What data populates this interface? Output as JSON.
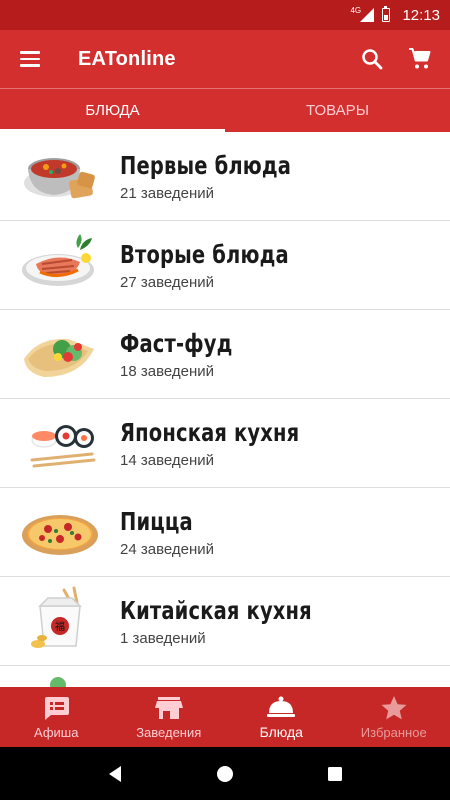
{
  "status_bar": {
    "network": "4G",
    "time": "12:13"
  },
  "app_bar": {
    "title": "EATonline",
    "icons": [
      "menu-icon",
      "search-icon",
      "cart-icon"
    ]
  },
  "tabs": [
    {
      "label": "БЛЮДА",
      "active": true
    },
    {
      "label": "ТОВАРЫ",
      "active": false
    }
  ],
  "categories": [
    {
      "title": "Первые блюда",
      "count": "21 заведений",
      "icon": "soup-bowl-icon"
    },
    {
      "title": "Вторые блюда",
      "count": "27 заведений",
      "icon": "grilled-fish-plate-icon"
    },
    {
      "title": "Фаст-фуд",
      "count": "18 заведений",
      "icon": "wrap-icon"
    },
    {
      "title": "Японская кухня",
      "count": "14 заведений",
      "icon": "sushi-icon"
    },
    {
      "title": "Пицца",
      "count": "24 заведений",
      "icon": "pizza-icon"
    },
    {
      "title": "Китайская кухня",
      "count": "1 заведений",
      "icon": "chinese-box-icon"
    }
  ],
  "bottom_nav": [
    {
      "label": "Афиша",
      "icon": "feed-icon",
      "state": "normal"
    },
    {
      "label": "Заведения",
      "icon": "store-icon",
      "state": "normal"
    },
    {
      "label": "Блюда",
      "icon": "cloche-icon",
      "state": "active"
    },
    {
      "label": "Избранное",
      "icon": "star-icon",
      "state": "faded"
    }
  ],
  "colors": {
    "status_bar": "#b71c1c",
    "app_bar": "#d32f2f",
    "bottom_nav": "#c62828",
    "system_nav": "#000000"
  }
}
